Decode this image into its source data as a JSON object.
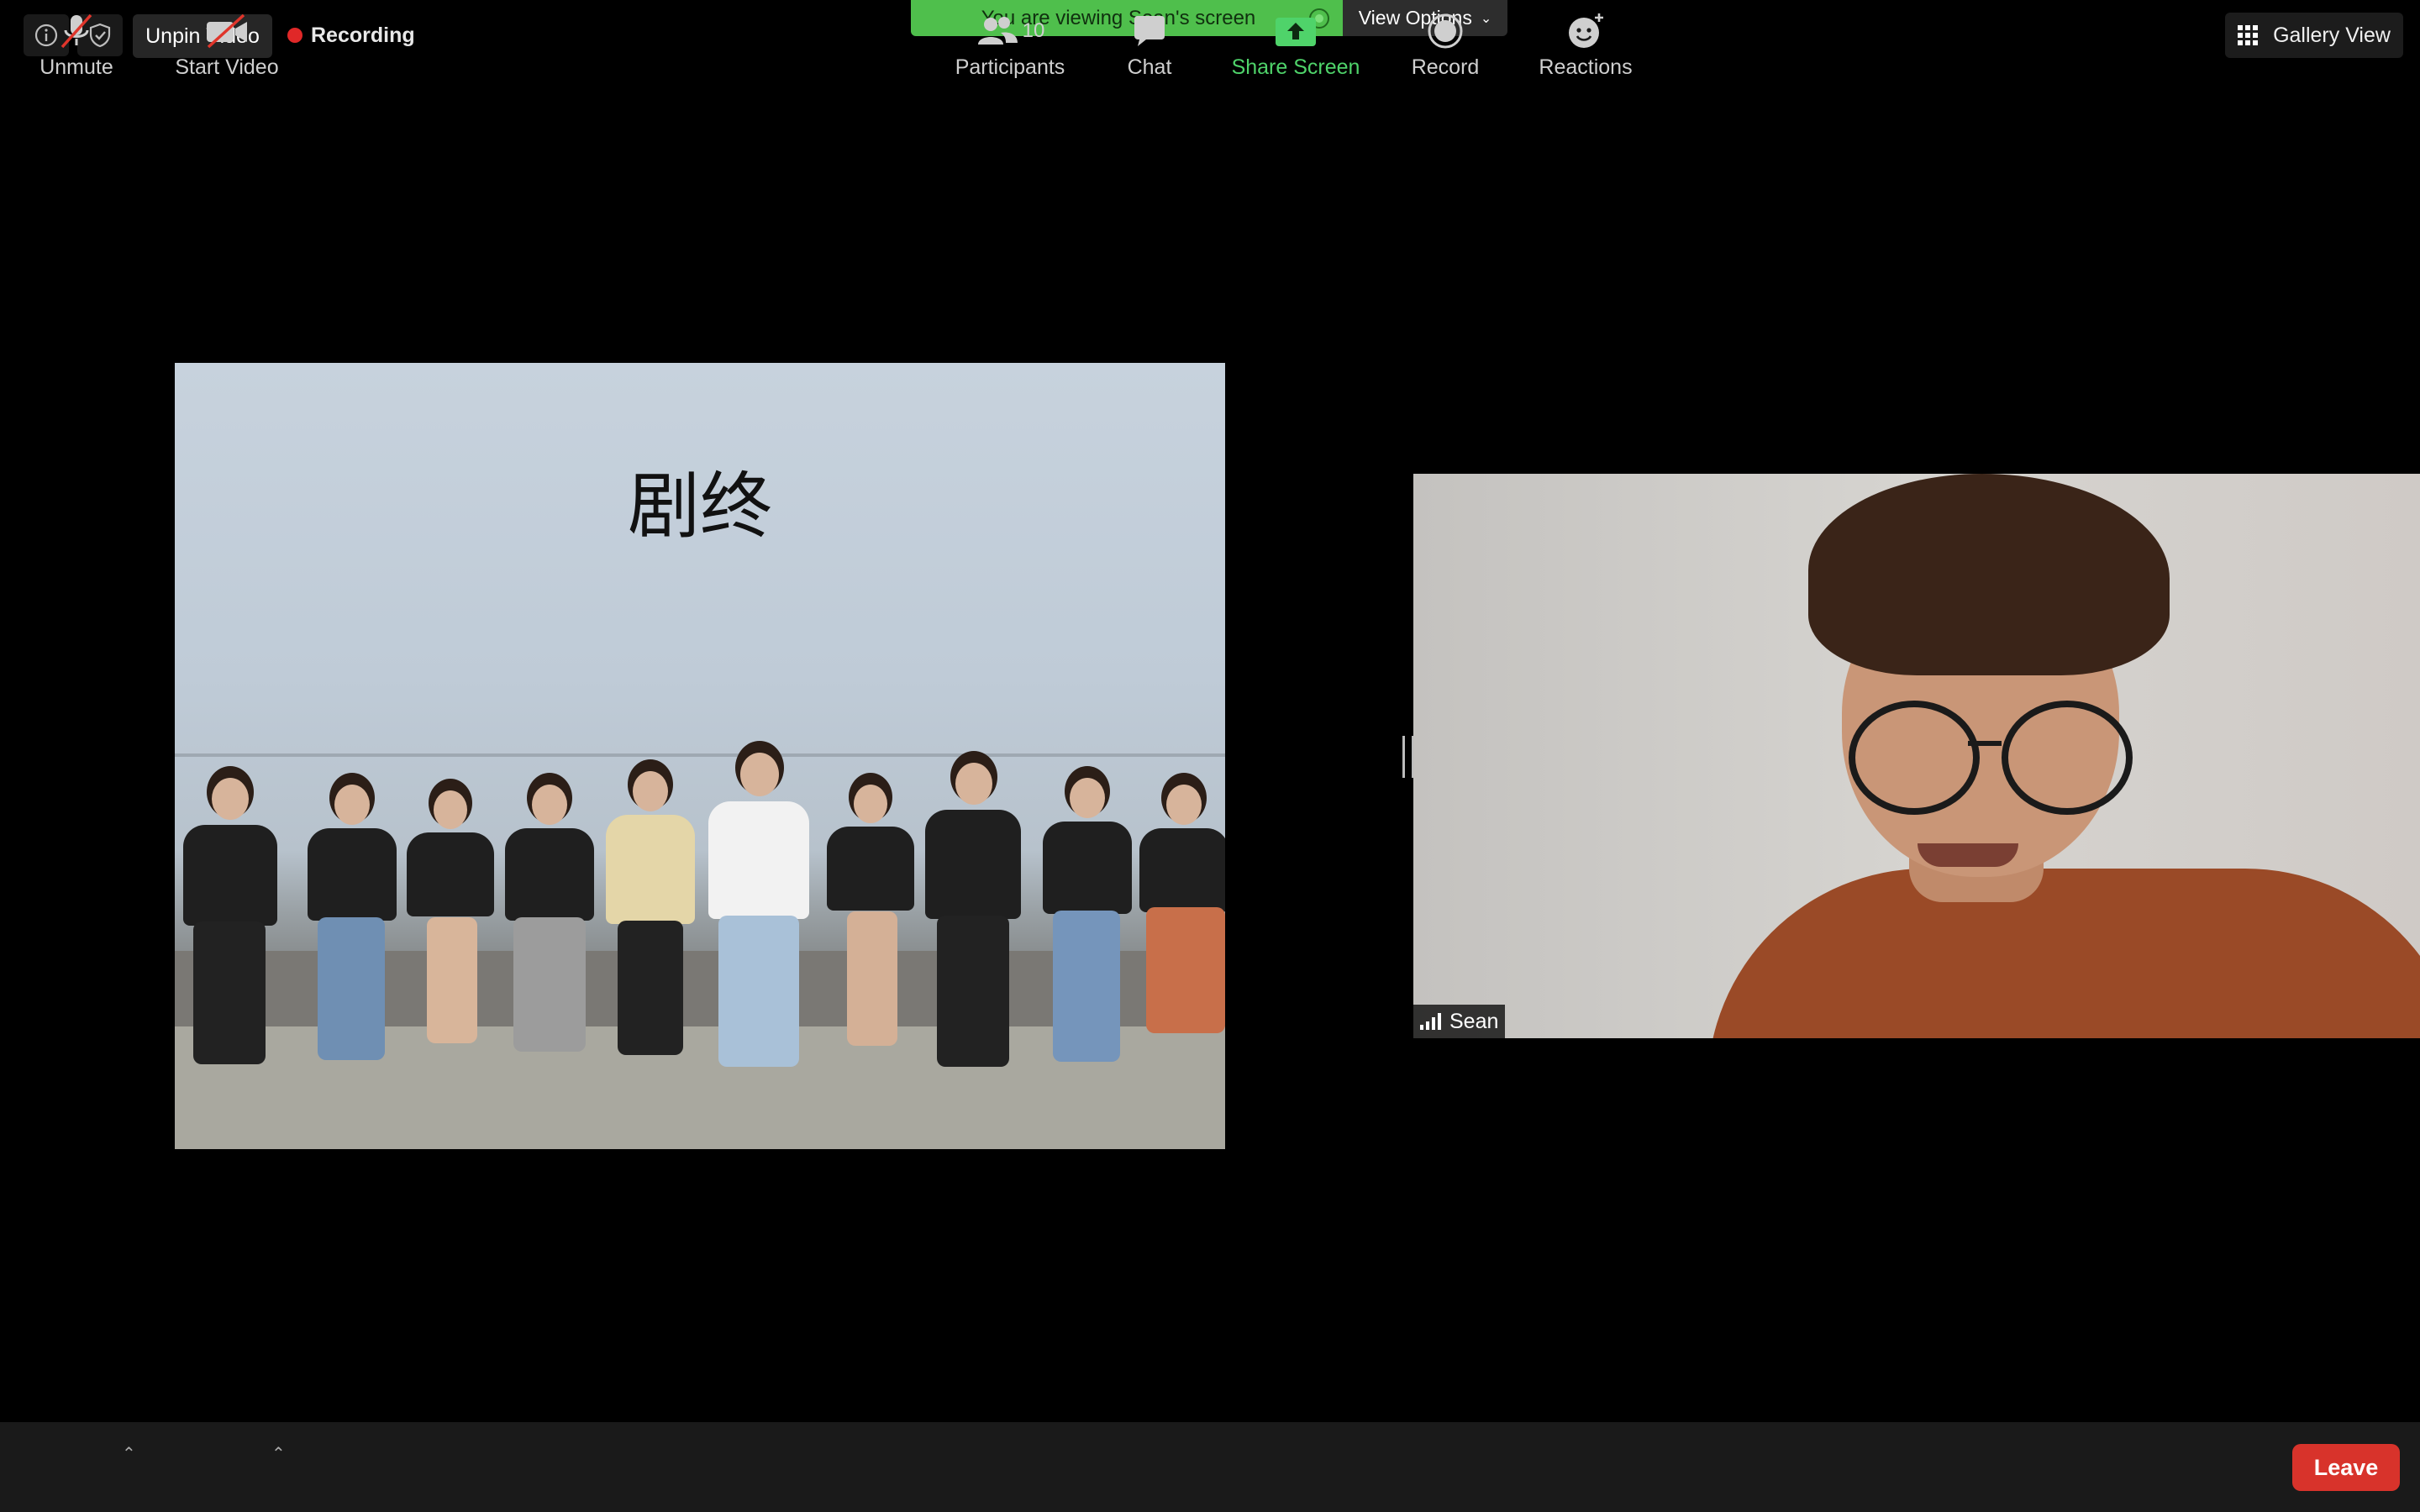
{
  "top_bar": {
    "info_icon": "info-icon",
    "security_icon": "shield-check-icon",
    "unpin_label": "Unpin Video",
    "recording_label": "Recording",
    "viewing_banner": "You are viewing Sean's screen",
    "view_options_label": "View Options",
    "gallery_label": "Gallery View"
  },
  "shared_screen": {
    "slide_title": "剧终"
  },
  "participant": {
    "name": "Sean"
  },
  "toolbar": {
    "unmute_label": "Unmute",
    "start_video_label": "Start Video",
    "participants_label": "Participants",
    "participants_count": "10",
    "chat_label": "Chat",
    "share_screen_label": "Share Screen",
    "record_label": "Record",
    "reactions_label": "Reactions",
    "leave_label": "Leave"
  },
  "colors": {
    "share_green": "#4fd36a",
    "banner_green": "#4fbf4c",
    "leave_red": "#d8332b",
    "recording_red": "#e02828"
  }
}
